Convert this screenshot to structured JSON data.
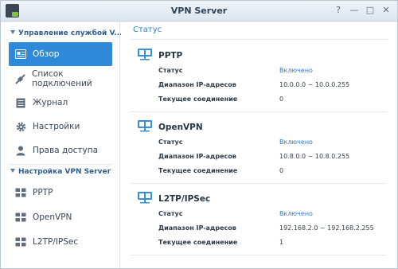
{
  "window": {
    "title": "VPN Server",
    "controls": [
      "?",
      "—",
      "□",
      "✕"
    ]
  },
  "sidebar": {
    "section1": "Управление службой V...",
    "items": [
      {
        "label": "Обзор",
        "icon": "overview-icon",
        "active": true
      },
      {
        "label": "Список подключений",
        "icon": "connections-icon",
        "active": false
      },
      {
        "label": "Журнал",
        "icon": "log-icon",
        "active": false
      },
      {
        "label": "Настройки",
        "icon": "gear-icon",
        "active": false
      },
      {
        "label": "Права доступа",
        "icon": "user-icon",
        "active": false
      }
    ],
    "section2": "Настройка VPN Server",
    "protocols": [
      {
        "label": "PPTP",
        "icon": "network-icon"
      },
      {
        "label": "OpenVPN",
        "icon": "network-icon"
      },
      {
        "label": "L2TP/IPSec",
        "icon": "network-icon"
      }
    ]
  },
  "content": {
    "tab": "Статус",
    "cards": [
      {
        "name": "PPTP",
        "rows": [
          {
            "label": "Статус",
            "value": "Включено"
          },
          {
            "label": "Диапазон IP-адресов",
            "value": "10.0.0.0 ~ 10.0.0.255"
          },
          {
            "label": "Текущее соединение",
            "value": "0"
          }
        ]
      },
      {
        "name": "OpenVPN",
        "rows": [
          {
            "label": "Статус",
            "value": "Включено"
          },
          {
            "label": "Диапазон IP-адресов",
            "value": "10.8.0.0 ~ 10.8.0.255"
          },
          {
            "label": "Текущее соединение",
            "value": "0"
          }
        ]
      },
      {
        "name": "L2TP/IPSec",
        "rows": [
          {
            "label": "Статус",
            "value": "Включено"
          },
          {
            "label": "Диапазон IP-адресов",
            "value": "192.168.2.0 ~ 192.168.2.255"
          },
          {
            "label": "Текущее соединение",
            "value": "1"
          }
        ]
      }
    ]
  },
  "colors": {
    "accent": "#2e89d8",
    "status_ok": "#2f7bc8"
  }
}
